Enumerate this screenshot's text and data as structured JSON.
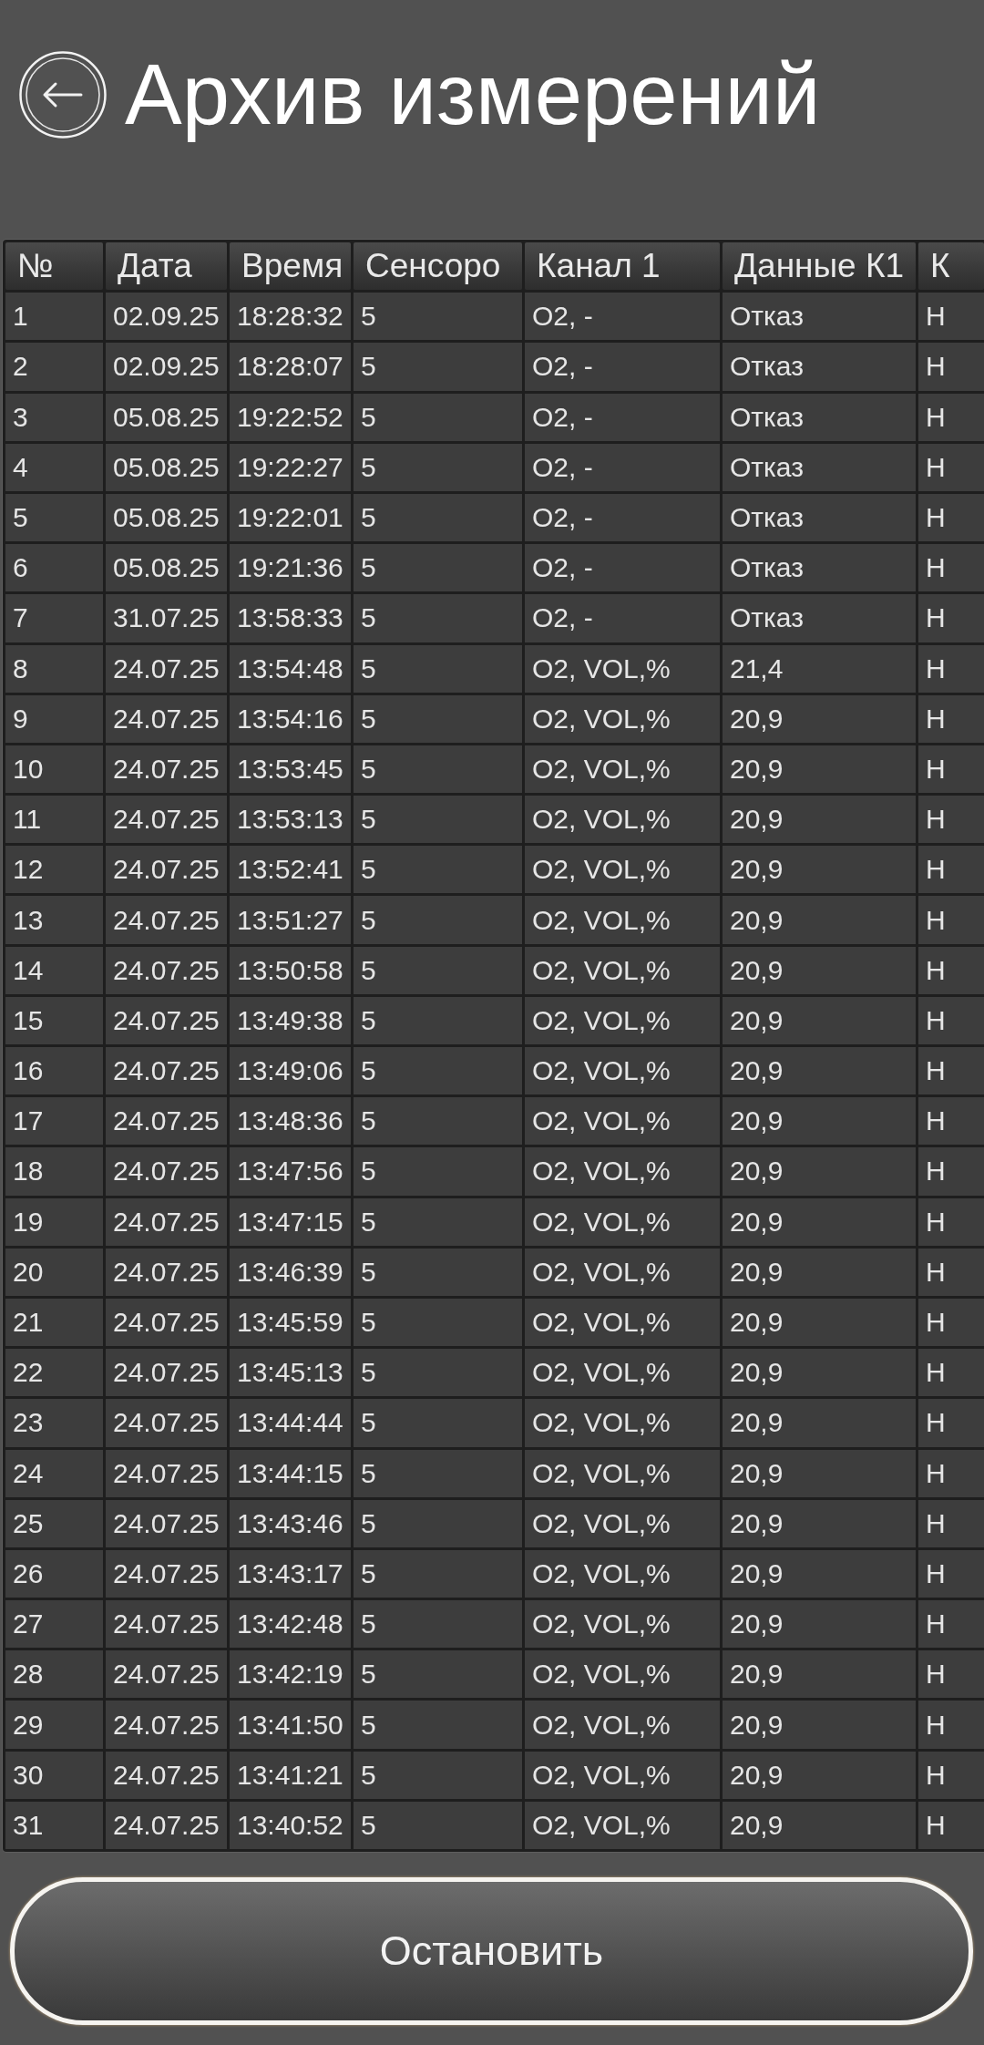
{
  "header": {
    "title": "Архив измерений"
  },
  "table": {
    "columns": [
      "№",
      "Дата",
      "Время",
      "Сенсоро",
      "Канал 1",
      "Данные К1",
      "К"
    ],
    "rows": [
      [
        "1",
        "02.09.25",
        "18:28:32",
        "5",
        "O2, -",
        "Отказ",
        "H"
      ],
      [
        "2",
        "02.09.25",
        "18:28:07",
        "5",
        "O2, -",
        "Отказ",
        "H"
      ],
      [
        "3",
        "05.08.25",
        "19:22:52",
        "5",
        "O2, -",
        "Отказ",
        "H"
      ],
      [
        "4",
        "05.08.25",
        "19:22:27",
        "5",
        "O2, -",
        "Отказ",
        "H"
      ],
      [
        "5",
        "05.08.25",
        "19:22:01",
        "5",
        "O2, -",
        "Отказ",
        "H"
      ],
      [
        "6",
        "05.08.25",
        "19:21:36",
        "5",
        "O2, -",
        "Отказ",
        "H"
      ],
      [
        "7",
        "31.07.25",
        "13:58:33",
        "5",
        "O2, -",
        "Отказ",
        "H"
      ],
      [
        "8",
        "24.07.25",
        "13:54:48",
        "5",
        "O2, VOL,%",
        "21,4",
        "H"
      ],
      [
        "9",
        "24.07.25",
        "13:54:16",
        "5",
        "O2, VOL,%",
        "20,9",
        "H"
      ],
      [
        "10",
        "24.07.25",
        "13:53:45",
        "5",
        "O2, VOL,%",
        "20,9",
        "H"
      ],
      [
        "11",
        "24.07.25",
        "13:53:13",
        "5",
        "O2, VOL,%",
        "20,9",
        "H"
      ],
      [
        "12",
        "24.07.25",
        "13:52:41",
        "5",
        "O2, VOL,%",
        "20,9",
        "H"
      ],
      [
        "13",
        "24.07.25",
        "13:51:27",
        "5",
        "O2, VOL,%",
        "20,9",
        "H"
      ],
      [
        "14",
        "24.07.25",
        "13:50:58",
        "5",
        "O2, VOL,%",
        "20,9",
        "H"
      ],
      [
        "15",
        "24.07.25",
        "13:49:38",
        "5",
        "O2, VOL,%",
        "20,9",
        "H"
      ],
      [
        "16",
        "24.07.25",
        "13:49:06",
        "5",
        "O2, VOL,%",
        "20,9",
        "H"
      ],
      [
        "17",
        "24.07.25",
        "13:48:36",
        "5",
        "O2, VOL,%",
        "20,9",
        "H"
      ],
      [
        "18",
        "24.07.25",
        "13:47:56",
        "5",
        "O2, VOL,%",
        "20,9",
        "H"
      ],
      [
        "19",
        "24.07.25",
        "13:47:15",
        "5",
        "O2, VOL,%",
        "20,9",
        "H"
      ],
      [
        "20",
        "24.07.25",
        "13:46:39",
        "5",
        "O2, VOL,%",
        "20,9",
        "H"
      ],
      [
        "21",
        "24.07.25",
        "13:45:59",
        "5",
        "O2, VOL,%",
        "20,9",
        "H"
      ],
      [
        "22",
        "24.07.25",
        "13:45:13",
        "5",
        "O2, VOL,%",
        "20,9",
        "H"
      ],
      [
        "23",
        "24.07.25",
        "13:44:44",
        "5",
        "O2, VOL,%",
        "20,9",
        "H"
      ],
      [
        "24",
        "24.07.25",
        "13:44:15",
        "5",
        "O2, VOL,%",
        "20,9",
        "H"
      ],
      [
        "25",
        "24.07.25",
        "13:43:46",
        "5",
        "O2, VOL,%",
        "20,9",
        "H"
      ],
      [
        "26",
        "24.07.25",
        "13:43:17",
        "5",
        "O2, VOL,%",
        "20,9",
        "H"
      ],
      [
        "27",
        "24.07.25",
        "13:42:48",
        "5",
        "O2, VOL,%",
        "20,9",
        "H"
      ],
      [
        "28",
        "24.07.25",
        "13:42:19",
        "5",
        "O2, VOL,%",
        "20,9",
        "H"
      ],
      [
        "29",
        "24.07.25",
        "13:41:50",
        "5",
        "O2, VOL,%",
        "20,9",
        "H"
      ],
      [
        "30",
        "24.07.25",
        "13:41:21",
        "5",
        "O2, VOL,%",
        "20,9",
        "H"
      ],
      [
        "31",
        "24.07.25",
        "13:40:52",
        "5",
        "O2, VOL,%",
        "20,9",
        "H"
      ]
    ]
  },
  "footer": {
    "button": "Остановить"
  }
}
